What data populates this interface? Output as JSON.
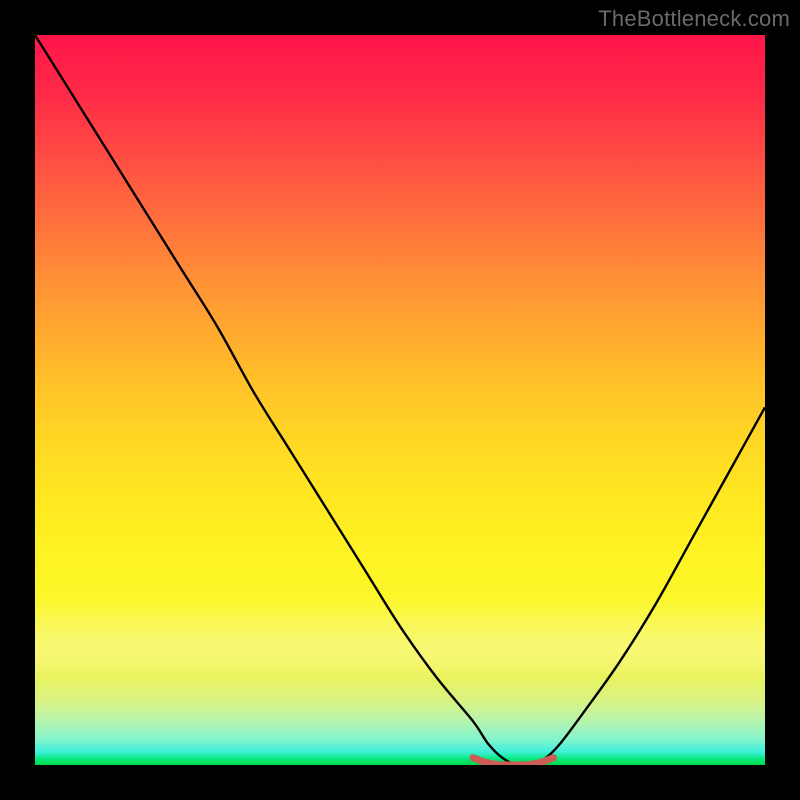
{
  "watermark": "TheBottleneck.com",
  "chart_data": {
    "type": "line",
    "title": "",
    "xlabel": "",
    "ylabel": "",
    "xlim": [
      0,
      100
    ],
    "ylim": [
      0,
      100
    ],
    "background_gradient": {
      "top_color": "#ff1549",
      "mid_color": "#ffe922",
      "bottom_color": "#00d843"
    },
    "series": [
      {
        "name": "bottleneck-curve",
        "color": "#000000",
        "x": [
          0,
          5,
          10,
          15,
          20,
          25,
          30,
          35,
          40,
          45,
          50,
          55,
          60,
          62,
          64,
          66,
          68,
          70,
          72,
          75,
          80,
          85,
          90,
          95,
          100
        ],
        "values": [
          100,
          92,
          84,
          76,
          68,
          60,
          51,
          43,
          35,
          27,
          19,
          12,
          6,
          3,
          1,
          0,
          0,
          1,
          3,
          7,
          14,
          22,
          31,
          40,
          49
        ]
      },
      {
        "name": "optimal-zone-marker",
        "color": "#cc5d54",
        "x": [
          60,
          61,
          62,
          63,
          64,
          65,
          66,
          67,
          68,
          69,
          70,
          71
        ],
        "values": [
          1,
          0.6,
          0.3,
          0.1,
          0,
          0,
          0,
          0,
          0.1,
          0.3,
          0.6,
          1
        ]
      }
    ],
    "annotations": []
  }
}
